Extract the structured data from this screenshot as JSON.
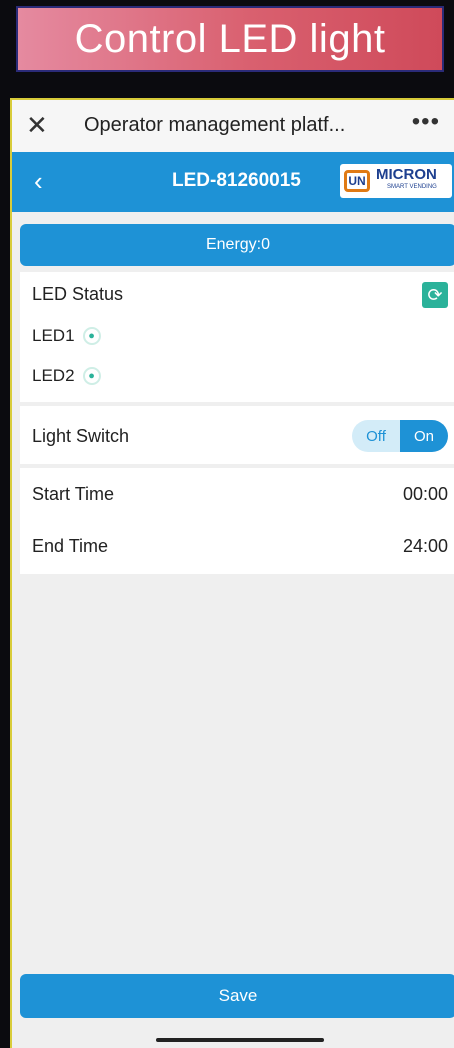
{
  "banner": {
    "text": "Control LED light"
  },
  "titlebar": {
    "close_icon": "close-icon",
    "title": "Operator management platf...",
    "more": "•••"
  },
  "navbar": {
    "back_icon": "chevron-left-icon",
    "device_id": "LED-81260015"
  },
  "logo": {
    "brand": "MICRON",
    "sub": "SMART VENDING",
    "mark": "UN"
  },
  "energy": {
    "text": "Energy:0"
  },
  "led_status": {
    "label": "LED Status",
    "items": [
      {
        "label": "LED1"
      },
      {
        "label": "LED2"
      }
    ]
  },
  "light_switch": {
    "label": "Light Switch",
    "off": "Off",
    "on": "On",
    "state": "on"
  },
  "schedule": {
    "start_label": "Start Time",
    "start_value": "00:00",
    "end_label": "End Time",
    "end_value": "24:00"
  },
  "save_label": "Save",
  "colors": {
    "primary": "#1e92d6",
    "accent": "#2bb29a",
    "banner": "#d9606f"
  }
}
